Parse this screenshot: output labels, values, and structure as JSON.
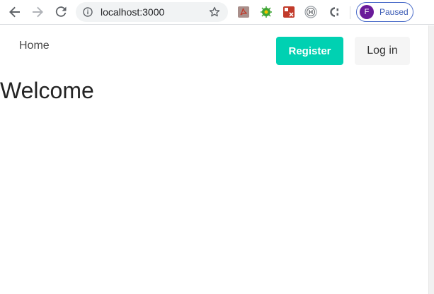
{
  "browser": {
    "url": "localhost:3000",
    "profile": {
      "initial": "F",
      "status": "Paused",
      "avatar_color": "#6a1b9a"
    },
    "icons": [
      "back-icon",
      "forward-icon",
      "reload-icon",
      "info-icon",
      "bookmark-star-icon",
      "pdf-extension-icon",
      "bug-extension-icon",
      "extension-icon",
      "h-extension-icon",
      "c-extension-icon"
    ]
  },
  "navbar": {
    "home_label": "Home",
    "register_label": "Register",
    "login_label": "Log in",
    "accent_color": "#00d1b2"
  },
  "main": {
    "title": "Welcome"
  }
}
